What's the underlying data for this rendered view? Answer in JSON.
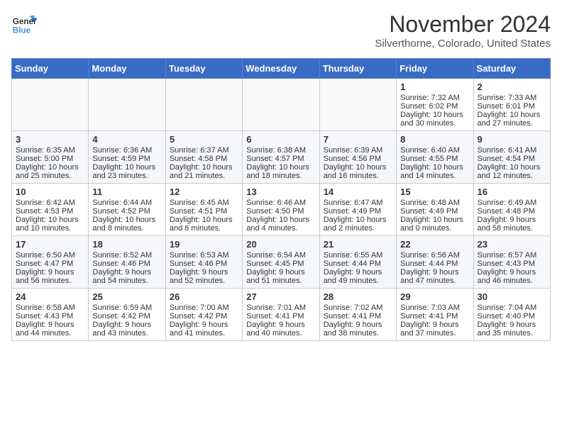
{
  "header": {
    "logo_line1": "General",
    "logo_line2": "Blue",
    "month": "November 2024",
    "location": "Silverthorne, Colorado, United States"
  },
  "weekdays": [
    "Sunday",
    "Monday",
    "Tuesday",
    "Wednesday",
    "Thursday",
    "Friday",
    "Saturday"
  ],
  "weeks": [
    [
      {
        "day": "",
        "lines": []
      },
      {
        "day": "",
        "lines": []
      },
      {
        "day": "",
        "lines": []
      },
      {
        "day": "",
        "lines": []
      },
      {
        "day": "",
        "lines": []
      },
      {
        "day": "1",
        "lines": [
          "Sunrise: 7:32 AM",
          "Sunset: 6:02 PM",
          "Daylight: 10 hours",
          "and 30 minutes."
        ]
      },
      {
        "day": "2",
        "lines": [
          "Sunrise: 7:33 AM",
          "Sunset: 6:01 PM",
          "Daylight: 10 hours",
          "and 27 minutes."
        ]
      }
    ],
    [
      {
        "day": "3",
        "lines": [
          "Sunrise: 6:35 AM",
          "Sunset: 5:00 PM",
          "Daylight: 10 hours",
          "and 25 minutes."
        ]
      },
      {
        "day": "4",
        "lines": [
          "Sunrise: 6:36 AM",
          "Sunset: 4:59 PM",
          "Daylight: 10 hours",
          "and 23 minutes."
        ]
      },
      {
        "day": "5",
        "lines": [
          "Sunrise: 6:37 AM",
          "Sunset: 4:58 PM",
          "Daylight: 10 hours",
          "and 21 minutes."
        ]
      },
      {
        "day": "6",
        "lines": [
          "Sunrise: 6:38 AM",
          "Sunset: 4:57 PM",
          "Daylight: 10 hours",
          "and 18 minutes."
        ]
      },
      {
        "day": "7",
        "lines": [
          "Sunrise: 6:39 AM",
          "Sunset: 4:56 PM",
          "Daylight: 10 hours",
          "and 16 minutes."
        ]
      },
      {
        "day": "8",
        "lines": [
          "Sunrise: 6:40 AM",
          "Sunset: 4:55 PM",
          "Daylight: 10 hours",
          "and 14 minutes."
        ]
      },
      {
        "day": "9",
        "lines": [
          "Sunrise: 6:41 AM",
          "Sunset: 4:54 PM",
          "Daylight: 10 hours",
          "and 12 minutes."
        ]
      }
    ],
    [
      {
        "day": "10",
        "lines": [
          "Sunrise: 6:42 AM",
          "Sunset: 4:53 PM",
          "Daylight: 10 hours",
          "and 10 minutes."
        ]
      },
      {
        "day": "11",
        "lines": [
          "Sunrise: 6:44 AM",
          "Sunset: 4:52 PM",
          "Daylight: 10 hours",
          "and 8 minutes."
        ]
      },
      {
        "day": "12",
        "lines": [
          "Sunrise: 6:45 AM",
          "Sunset: 4:51 PM",
          "Daylight: 10 hours",
          "and 6 minutes."
        ]
      },
      {
        "day": "13",
        "lines": [
          "Sunrise: 6:46 AM",
          "Sunset: 4:50 PM",
          "Daylight: 10 hours",
          "and 4 minutes."
        ]
      },
      {
        "day": "14",
        "lines": [
          "Sunrise: 6:47 AM",
          "Sunset: 4:49 PM",
          "Daylight: 10 hours",
          "and 2 minutes."
        ]
      },
      {
        "day": "15",
        "lines": [
          "Sunrise: 6:48 AM",
          "Sunset: 4:49 PM",
          "Daylight: 10 hours",
          "and 0 minutes."
        ]
      },
      {
        "day": "16",
        "lines": [
          "Sunrise: 6:49 AM",
          "Sunset: 4:48 PM",
          "Daylight: 9 hours",
          "and 58 minutes."
        ]
      }
    ],
    [
      {
        "day": "17",
        "lines": [
          "Sunrise: 6:50 AM",
          "Sunset: 4:47 PM",
          "Daylight: 9 hours",
          "and 56 minutes."
        ]
      },
      {
        "day": "18",
        "lines": [
          "Sunrise: 6:52 AM",
          "Sunset: 4:46 PM",
          "Daylight: 9 hours",
          "and 54 minutes."
        ]
      },
      {
        "day": "19",
        "lines": [
          "Sunrise: 6:53 AM",
          "Sunset: 4:46 PM",
          "Daylight: 9 hours",
          "and 52 minutes."
        ]
      },
      {
        "day": "20",
        "lines": [
          "Sunrise: 6:54 AM",
          "Sunset: 4:45 PM",
          "Daylight: 9 hours",
          "and 51 minutes."
        ]
      },
      {
        "day": "21",
        "lines": [
          "Sunrise: 6:55 AM",
          "Sunset: 4:44 PM",
          "Daylight: 9 hours",
          "and 49 minutes."
        ]
      },
      {
        "day": "22",
        "lines": [
          "Sunrise: 6:56 AM",
          "Sunset: 4:44 PM",
          "Daylight: 9 hours",
          "and 47 minutes."
        ]
      },
      {
        "day": "23",
        "lines": [
          "Sunrise: 6:57 AM",
          "Sunset: 4:43 PM",
          "Daylight: 9 hours",
          "and 46 minutes."
        ]
      }
    ],
    [
      {
        "day": "24",
        "lines": [
          "Sunrise: 6:58 AM",
          "Sunset: 4:43 PM",
          "Daylight: 9 hours",
          "and 44 minutes."
        ]
      },
      {
        "day": "25",
        "lines": [
          "Sunrise: 6:59 AM",
          "Sunset: 4:42 PM",
          "Daylight: 9 hours",
          "and 43 minutes."
        ]
      },
      {
        "day": "26",
        "lines": [
          "Sunrise: 7:00 AM",
          "Sunset: 4:42 PM",
          "Daylight: 9 hours",
          "and 41 minutes."
        ]
      },
      {
        "day": "27",
        "lines": [
          "Sunrise: 7:01 AM",
          "Sunset: 4:41 PM",
          "Daylight: 9 hours",
          "and 40 minutes."
        ]
      },
      {
        "day": "28",
        "lines": [
          "Sunrise: 7:02 AM",
          "Sunset: 4:41 PM",
          "Daylight: 9 hours",
          "and 38 minutes."
        ]
      },
      {
        "day": "29",
        "lines": [
          "Sunrise: 7:03 AM",
          "Sunset: 4:41 PM",
          "Daylight: 9 hours",
          "and 37 minutes."
        ]
      },
      {
        "day": "30",
        "lines": [
          "Sunrise: 7:04 AM",
          "Sunset: 4:40 PM",
          "Daylight: 9 hours",
          "and 35 minutes."
        ]
      }
    ]
  ]
}
